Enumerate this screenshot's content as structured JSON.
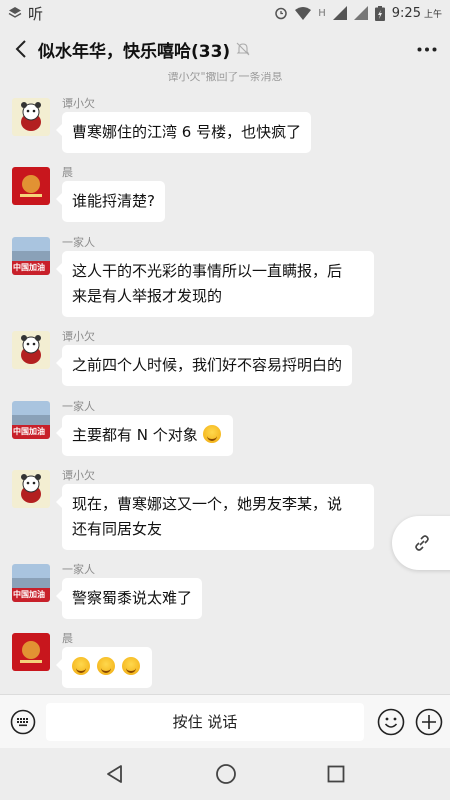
{
  "status_bar": {
    "left_glyph": "听",
    "network": "H",
    "time": "9:25",
    "ampm": "上午"
  },
  "header": {
    "title": "似水年华，快乐嘻哈(33)"
  },
  "system_message": "谭小欠\"撤回了一条消息",
  "messages": [
    {
      "sender": "谭小欠",
      "avatar": "cartoon-avatar",
      "text": "曹寒娜住的江湾 6 号楼，也快疯了"
    },
    {
      "sender": "晨",
      "avatar": "flag-avatar",
      "text": "谁能捋清楚?"
    },
    {
      "sender": "一家人",
      "avatar": "china-avatar",
      "avatar_text": "中国加油",
      "text_line1": "这人干的不光彩的事情所以一直瞒报，后",
      "text_line2": "来是有人举报才发现的"
    },
    {
      "sender": "谭小欠",
      "avatar": "cartoon-avatar",
      "text": "之前四个人时候，我们好不容易捋明白的"
    },
    {
      "sender": "一家人",
      "avatar": "china-avatar",
      "avatar_text": "中国加油",
      "text": "主要都有 N 个对象"
    },
    {
      "sender": "谭小欠",
      "avatar": "cartoon-avatar",
      "text_line1": "现在，曹寒娜这又一个，她男友李某，说",
      "text_line2": "还有同居女友"
    },
    {
      "sender": "一家人",
      "avatar": "china-avatar",
      "avatar_text": "中国加油",
      "text": "警察蜀黍说太难了"
    },
    {
      "sender": "晨",
      "avatar": "flag-avatar",
      "text": ""
    }
  ],
  "input_bar": {
    "hold_to_talk": "按住 说话"
  },
  "icons": [
    "back-arrow-icon",
    "more-icon",
    "mute-icon",
    "link-icon",
    "keyboard-icon",
    "emoji-icon",
    "plus-icon",
    "nav-back-icon",
    "nav-home-icon",
    "nav-recent-icon"
  ]
}
